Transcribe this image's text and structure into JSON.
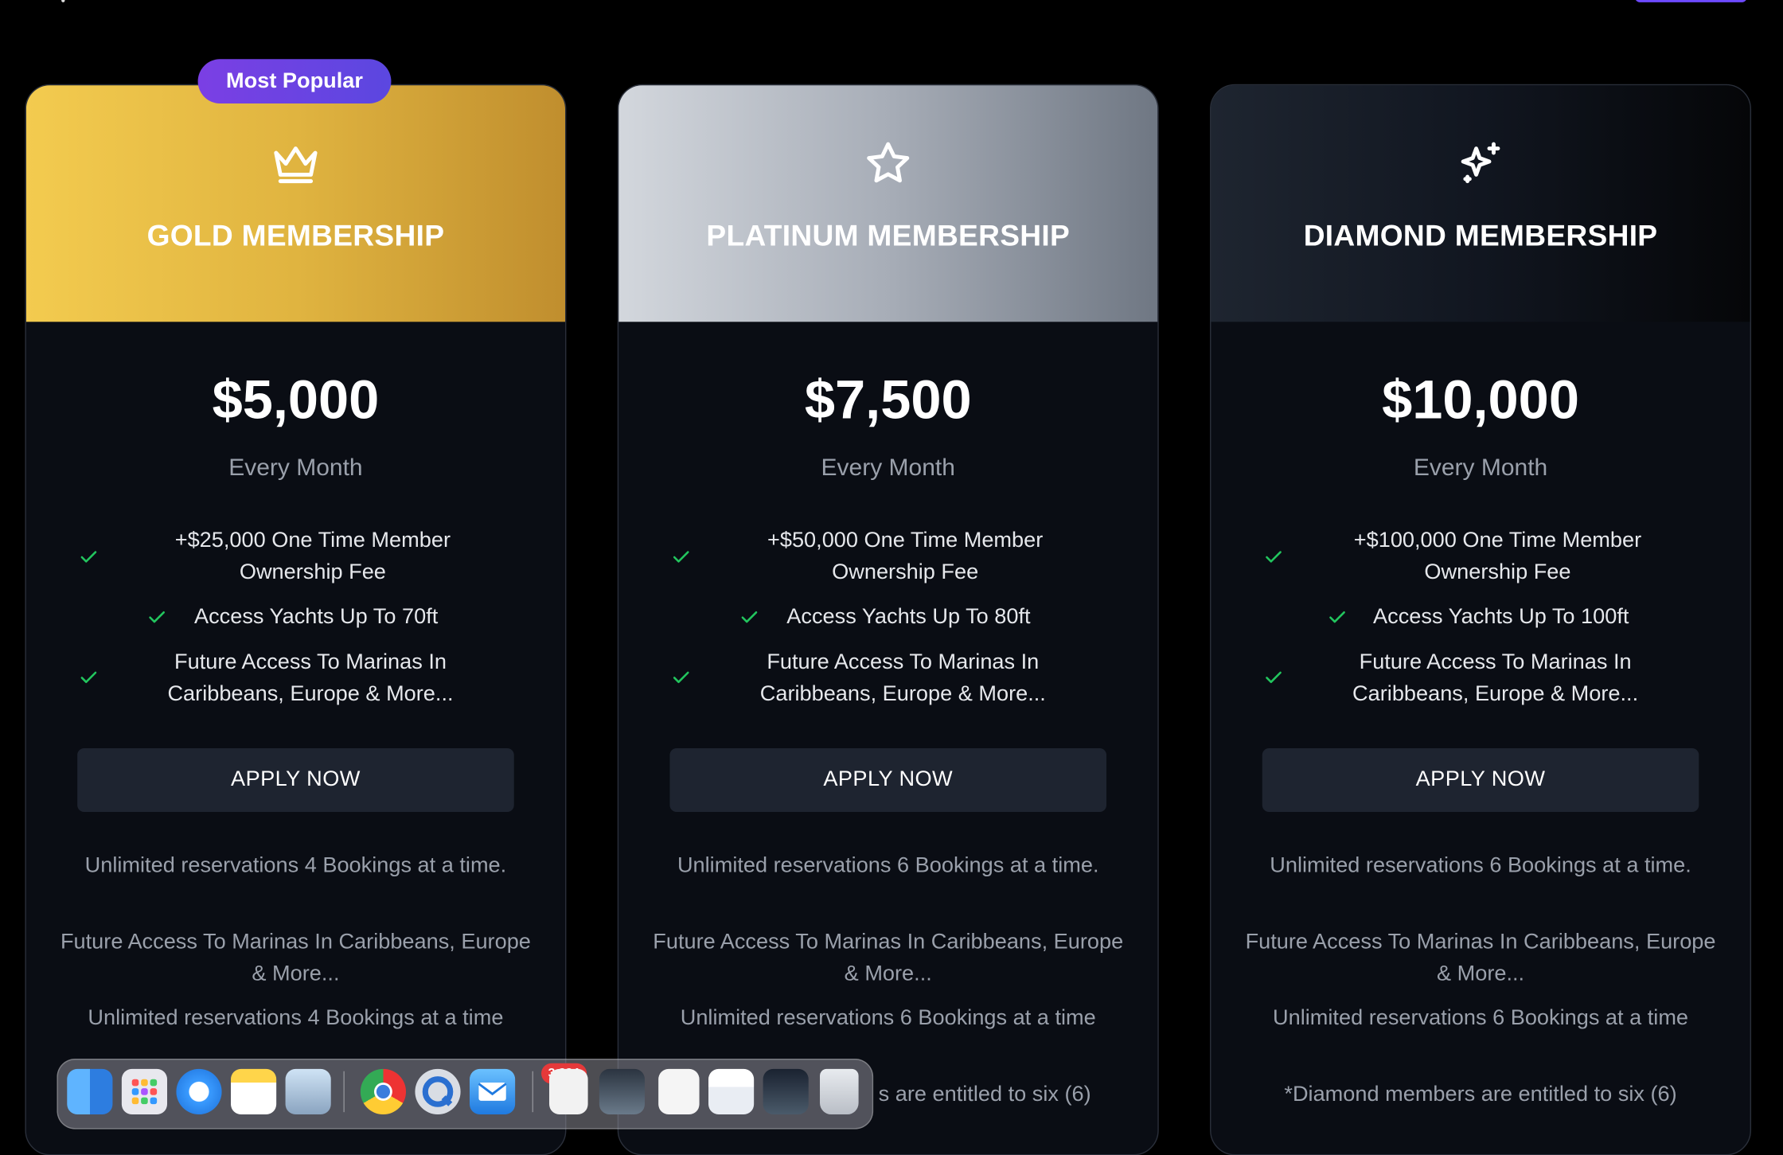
{
  "badge": {
    "label": "Most Popular"
  },
  "plans": [
    {
      "id": "gold",
      "icon": "crown-icon",
      "title": "GOLD MEMBERSHIP",
      "price": "$5,000",
      "period": "Every Month",
      "features": [
        "+$25,000 One Time Member Ownership Fee",
        "Access Yachts Up To 70ft",
        "Future Access To Marinas In Caribbeans, Europe & More..."
      ],
      "apply_label": "APPLY NOW",
      "notes": [
        "Unlimited reservations 4 Bookings at a time.",
        "Future Access To Marinas In Caribbeans, Europe & More...",
        "Unlimited reservations 4 Bookings at a time"
      ]
    },
    {
      "id": "platinum",
      "icon": "star-icon",
      "title": "PLATINUM MEMBERSHIP",
      "price": "$7,500",
      "period": "Every Month",
      "features": [
        "+$50,000 One Time Member Ownership Fee",
        "Access Yachts Up To 80ft",
        "Future Access To Marinas In Caribbeans, Europe & More..."
      ],
      "apply_label": "APPLY NOW",
      "notes": [
        "Unlimited reservations 6 Bookings at a time.",
        "Future Access To Marinas In Caribbeans, Europe & More...",
        "Unlimited reservations 6 Bookings at a time",
        "s are entitled to six (6)"
      ]
    },
    {
      "id": "diamond",
      "icon": "sparkles-icon",
      "title": "DIAMOND MEMBERSHIP",
      "price": "$10,000",
      "period": "Every Month",
      "features": [
        "+$100,000 One Time Member Ownership Fee",
        "Access Yachts Up To 100ft",
        "Future Access To Marinas In Caribbeans, Europe & More..."
      ],
      "apply_label": "APPLY NOW",
      "notes": [
        "Unlimited reservations 6 Bookings at a time.",
        "Future Access To Marinas In Caribbeans, Europe & More...",
        "Unlimited reservations 6 Bookings at a time",
        "*Diamond members are entitled to six (6)"
      ]
    }
  ],
  "dock": {
    "mail_badge": "3,884",
    "apps": [
      "finder-icon",
      "launchpad-icon",
      "safari-icon",
      "notes-icon",
      "preview-icon",
      "chrome-icon",
      "quicktime-icon",
      "mail-icon",
      "document-icon",
      "screenshot-icon",
      "document-list-icon",
      "browser-window-icon",
      "chrome-window-icon",
      "trash-icon"
    ]
  },
  "colors": {
    "gold_start": "#f3cb4f",
    "gold_end": "#c08e2e",
    "platinum_start": "#d3d7dd",
    "platinum_end": "#6f7783",
    "diamond_start": "#1e2530",
    "diamond_end": "#050608",
    "check_green": "#22c55e",
    "badge_start": "#7b3fe4",
    "badge_end": "#5b47e0"
  }
}
